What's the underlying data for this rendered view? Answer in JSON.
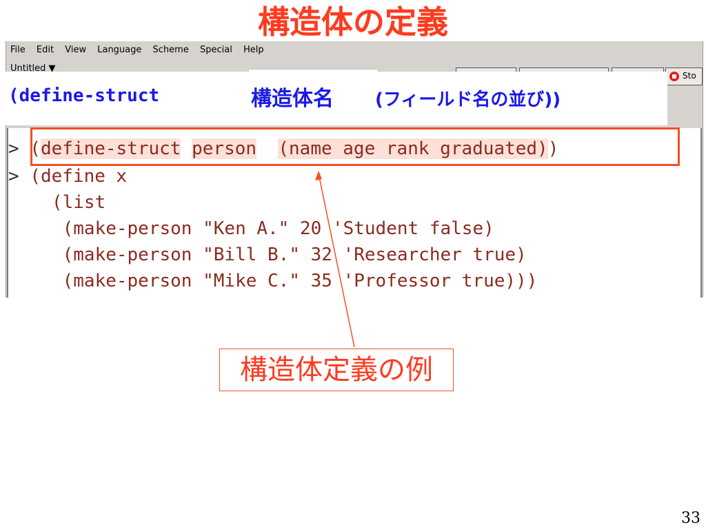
{
  "slide": {
    "title": "構造体の定義",
    "page_number": "33"
  },
  "menu": {
    "items": [
      "File",
      "Edit",
      "View",
      "Language",
      "Scheme",
      "Special",
      "Help"
    ]
  },
  "toolbar": {
    "file_name": "Untitled ▼",
    "stop_label": "Sto"
  },
  "callout": {
    "code": "(define-struct",
    "struct_name": "構造体名",
    "fields": "(フィールド名の並び))"
  },
  "editor": {
    "lines": [
      {
        "prompt": ">",
        "segments": [
          "(",
          "define-struct",
          " ",
          "person",
          "  ",
          "(name age rank graduated)",
          ")"
        ]
      },
      {
        "prompt": ">",
        "text": "(define x"
      },
      {
        "text": "   (list"
      },
      {
        "text": "    (make-person \"Ken A.\" 20 'Student false)"
      },
      {
        "text": "    (make-person \"Bill B.\" 32 'Researcher true)"
      },
      {
        "text": "    (make-person \"Mike C.\" 35 'Professor true)))"
      }
    ]
  },
  "annotation": {
    "label": "構造体定義の例"
  }
}
